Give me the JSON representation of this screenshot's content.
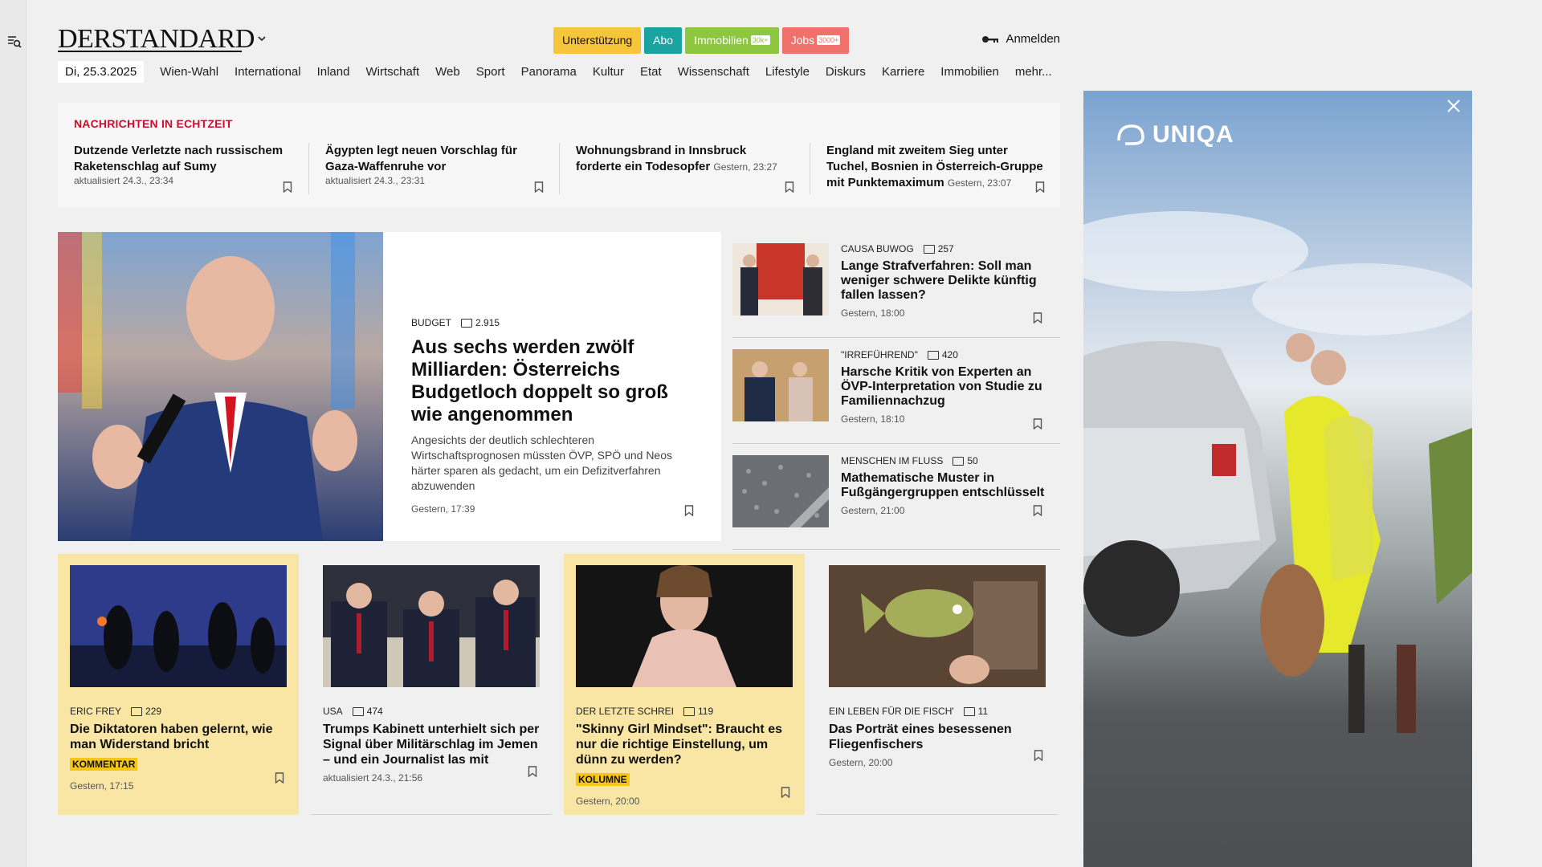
{
  "header": {
    "logo": "DERSTANDARD",
    "pills": [
      {
        "label": "Unterstützung",
        "badge": ""
      },
      {
        "label": "Abo",
        "badge": ""
      },
      {
        "label": "Immobilien",
        "badge": "30k+"
      },
      {
        "label": "Jobs",
        "badge": "3000+"
      }
    ],
    "login": "Anmelden"
  },
  "nav": {
    "date": "Di, 25.3.2025",
    "items": [
      "Wien-Wahl",
      "International",
      "Inland",
      "Wirtschaft",
      "Web",
      "Sport",
      "Panorama",
      "Kultur",
      "Etat",
      "Wissenschaft",
      "Lifestyle",
      "Diskurs",
      "Karriere",
      "Immobilien",
      "mehr..."
    ]
  },
  "live": {
    "heading": "NACHRICHTEN IN ECHTZEIT",
    "items": [
      {
        "title": "Dutzende Verletzte nach russischem Raketenschlag auf Sumy",
        "meta": "aktualisiert 24.3., 23:34"
      },
      {
        "title": "Ägypten legt neuen Vorschlag für Gaza-Waffenruhe vor",
        "meta": "aktualisiert 24.3., 23:31"
      },
      {
        "title": "Wohnungsbrand in Innsbruck forderte ein Todesopfer",
        "meta": "Gestern, 23:27"
      },
      {
        "title": "England mit zweitem Sieg unter Tuchel, Bosnien in Österreich-Gruppe mit Punktemaximum",
        "meta": "Gestern, 23:07"
      }
    ]
  },
  "hero": {
    "kicker": "BUDGET",
    "comments": "2.915",
    "title": "Aus sechs werden zwölf Milliarden: Österreichs Budgetloch doppelt so groß wie angenommen",
    "teaser": "Angesichts der deutlich schlechteren Wirtschaftsprognosen müssten ÖVP, SPÖ und Neos härter sparen als gedacht, um ein Defizitverfahren abzuwenden",
    "time": "Gestern, 17:39"
  },
  "side": [
    {
      "kicker": "CAUSA BUWOG",
      "comments": "257",
      "title": "Lange Strafverfahren: Soll man weniger schwere Delikte künftig fallen lassen?",
      "time": "Gestern, 18:00"
    },
    {
      "kicker": "\"IRREFÜHREND\"",
      "comments": "420",
      "title": "Harsche Kritik von Experten an ÖVP-Interpretation von Studie zu Familiennachzug",
      "time": "Gestern, 18:10"
    },
    {
      "kicker": "MENSCHEN IM FLUSS",
      "comments": "50",
      "title": "Mathematische Muster in Fußgängergruppen entschlüsselt",
      "time": "Gestern, 21:00"
    }
  ],
  "cards": [
    {
      "kicker": "ERIC FREY",
      "comments": "229",
      "title": "Die Diktatoren haben gelernt, wie man Widerstand bricht",
      "tag": "KOMMENTAR",
      "time": "Gestern, 17:15"
    },
    {
      "kicker": "USA",
      "comments": "474",
      "title": "Trumps Kabinett unterhielt sich per Signal über Militärschlag im Jemen – und ein Journalist las mit",
      "tag": "",
      "time": "aktualisiert 24.3., 21:56"
    },
    {
      "kicker": "DER LETZTE SCHREI",
      "comments": "119",
      "title": "\"Skinny Girl Mindset\": Braucht es nur die richtige Einstellung, um dünn zu werden?",
      "tag": "KOLUMNE",
      "time": "Gestern, 20:00"
    },
    {
      "kicker": "EIN LEBEN FÜR DIE FISCH'",
      "comments": "11",
      "title": "Das Porträt eines besessenen Fliegenfischers",
      "tag": "",
      "time": "Gestern, 20:00"
    }
  ],
  "ad": {
    "brand": "UNIQA"
  },
  "colors": {
    "accent_red": "#c8102e",
    "support": "#f6c53a",
    "abo": "#19a3a1",
    "immobilien": "#8dc63f",
    "jobs": "#f0716a",
    "highlight": "#f9e6a5"
  }
}
